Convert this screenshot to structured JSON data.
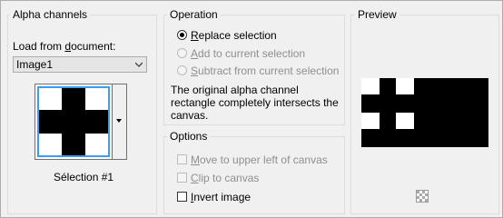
{
  "alpha_channels": {
    "title": "Alpha channels",
    "load_from_label": "Load from document:",
    "load_from_ul": "d",
    "document_value": "Image1",
    "selection_name": "Sélection #1"
  },
  "operation": {
    "title": "Operation",
    "options": [
      {
        "ul": "R",
        "rest": "eplace selection",
        "selected": true,
        "enabled": true
      },
      {
        "ul": "A",
        "rest": "dd to current selection",
        "selected": false,
        "enabled": false
      },
      {
        "ul": "S",
        "rest": "ubtract from current selection",
        "selected": false,
        "enabled": false
      }
    ],
    "message_line1": "The original alpha channel",
    "message_line2": "rectangle completely intersects the",
    "message_line3": "canvas."
  },
  "options": {
    "title": "Options",
    "checkboxes": [
      {
        "ul": "M",
        "rest": "ove to upper left of canvas",
        "checked": false,
        "enabled": false
      },
      {
        "ul": "C",
        "rest": "lip to canvas",
        "checked": false,
        "enabled": false
      },
      {
        "ul": "I",
        "rest": "nvert image",
        "checked": false,
        "enabled": true
      }
    ]
  },
  "preview": {
    "title": "Preview",
    "transparency_icon": "checkerboard-icon"
  }
}
